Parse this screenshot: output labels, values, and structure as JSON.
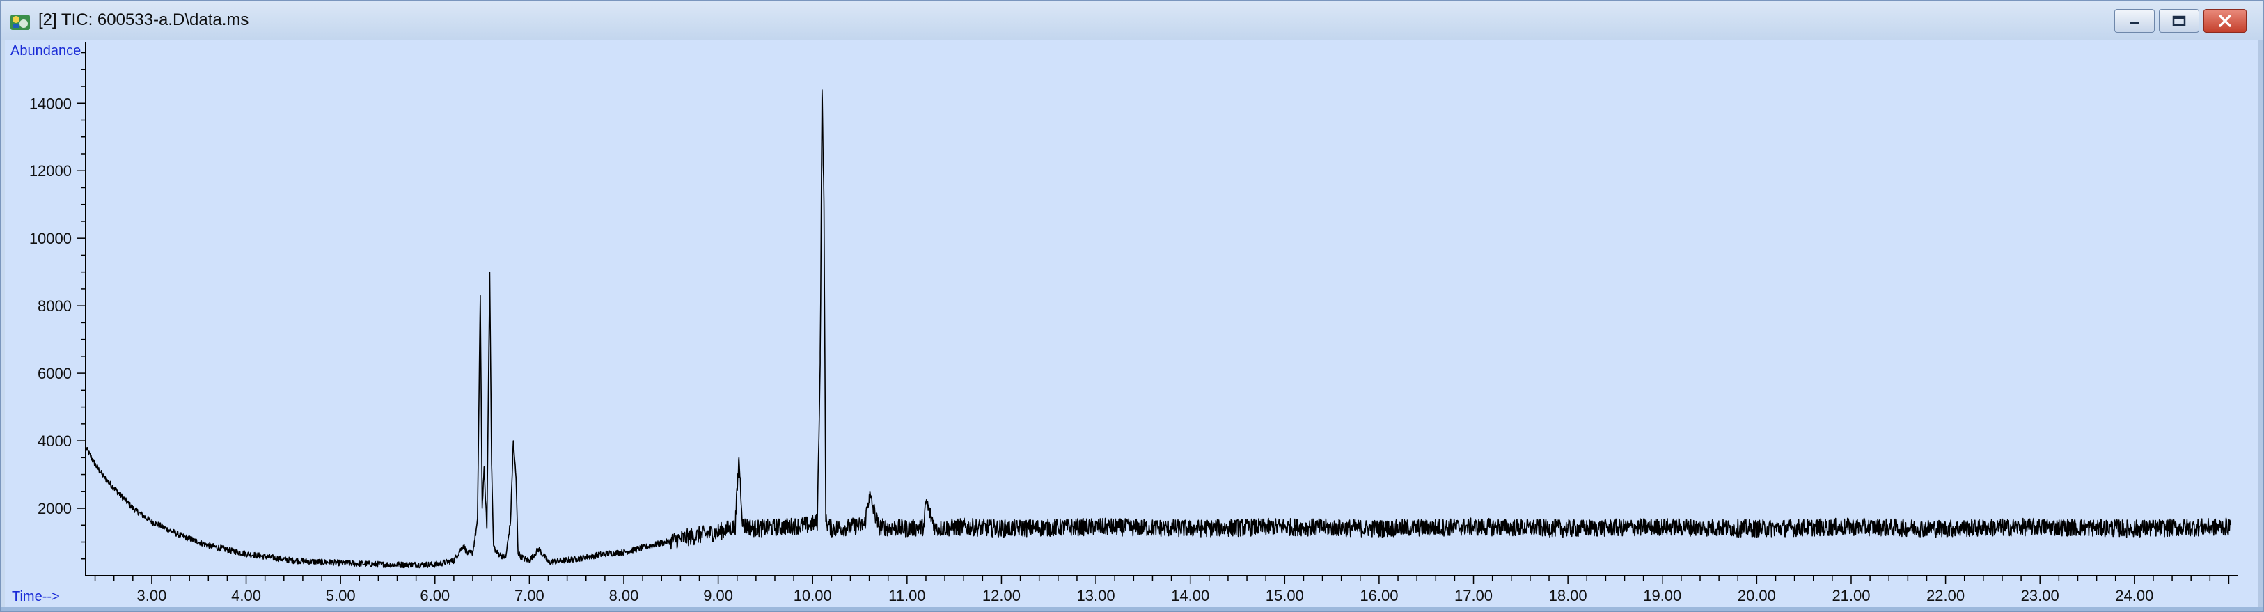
{
  "window": {
    "title": "[2] TIC: 600533-a.D\\data.ms",
    "icon": "chromatogram-app-icon",
    "buttons": {
      "minimize": "minimize-icon",
      "maximize": "restore-icon",
      "close": "close-icon"
    }
  },
  "colors": {
    "plot_background": "#d0e1fb",
    "trace": "#000000",
    "axis_captions": "#1a2bd6",
    "close_button": "#c4402c"
  },
  "chart_data": {
    "type": "line",
    "title": "",
    "ylabel": "Abundance",
    "xlabel": "Time-->",
    "xlim": [
      2.3,
      25.1
    ],
    "ylim": [
      0,
      15800
    ],
    "x_ticks": [
      "3.00",
      "4.00",
      "5.00",
      "6.00",
      "7.00",
      "8.00",
      "9.00",
      "10.00",
      "11.00",
      "12.00",
      "13.00",
      "14.00",
      "15.00",
      "16.00",
      "17.00",
      "18.00",
      "19.00",
      "20.00",
      "21.00",
      "22.00",
      "23.00",
      "24.00"
    ],
    "y_ticks": [
      "2000",
      "4000",
      "6000",
      "8000",
      "10000",
      "12000",
      "14000"
    ],
    "grid": false,
    "legend": "none",
    "series": [
      {
        "x": [
          2.3,
          2.4,
          2.5,
          2.6,
          2.8,
          3.0,
          3.3,
          3.6,
          4.0,
          4.5,
          5.0,
          5.5,
          6.0,
          6.2,
          6.3,
          6.35,
          6.4,
          6.45,
          6.48,
          6.5,
          6.52,
          6.55,
          6.58,
          6.6,
          6.62,
          6.65,
          6.7,
          6.75,
          6.8,
          6.83,
          6.86,
          6.88,
          6.9,
          6.95,
          7.0,
          7.1,
          7.2,
          7.5,
          7.8,
          8.0,
          8.3,
          8.6,
          9.0,
          9.18,
          9.22,
          9.26,
          9.4,
          9.7,
          9.95,
          10.05,
          10.08,
          10.1,
          10.12,
          10.14,
          10.2,
          10.4,
          10.55,
          10.6,
          10.7,
          11.0,
          11.18,
          11.2,
          11.3,
          11.6,
          12.0,
          13.0,
          14.0,
          15.0,
          16.0,
          17.0,
          18.0,
          19.0,
          20.0,
          21.0,
          22.0,
          23.0,
          24.0,
          25.0
        ],
        "y": [
          3800,
          3300,
          2900,
          2600,
          2000,
          1600,
          1200,
          900,
          650,
          450,
          380,
          330,
          330,
          450,
          900,
          650,
          700,
          1600,
          8300,
          2000,
          3200,
          1400,
          9000,
          3300,
          900,
          700,
          600,
          550,
          1600,
          4000,
          2800,
          700,
          600,
          500,
          450,
          800,
          400,
          500,
          650,
          700,
          900,
          1100,
          1300,
          1450,
          3500,
          1500,
          1400,
          1450,
          1500,
          1600,
          6300,
          14400,
          11100,
          1600,
          1400,
          1450,
          1500,
          2400,
          1450,
          1400,
          1450,
          2200,
          1400,
          1450,
          1400,
          1450,
          1400,
          1450,
          1400,
          1450,
          1400,
          1450,
          1400,
          1450,
          1400,
          1450,
          1400,
          1450
        ]
      }
    ]
  }
}
